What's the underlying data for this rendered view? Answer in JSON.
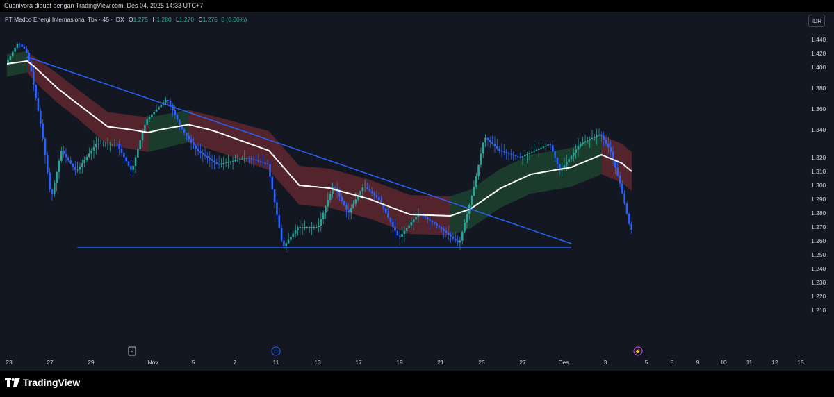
{
  "header": {
    "attribution": "Cuanivora dibuat dengan TradingView.com, Des 04, 2025 14:33 UTC+7"
  },
  "legend": {
    "symbol": "PT Medco Energi Internasional Tbk · 45 · IDX",
    "open_label": "O",
    "open": "1.275",
    "high_label": "H",
    "high": "1.280",
    "low_label": "L",
    "low": "1.270",
    "close_label": "C",
    "close": "1.275",
    "change": "0 (0,00%)"
  },
  "currency_button": "IDR",
  "brand": {
    "name": "TradingView"
  },
  "colors": {
    "background": "#131722",
    "up": "#26a69a",
    "down": "#2962ff",
    "trendline": "#2962ff",
    "band_bear": "#6b2a30",
    "band_bull": "#1f4a31",
    "ma_line": "#ffffff"
  },
  "chart_data": {
    "type": "candlestick",
    "yaxis": {
      "ticks": [
        "1.440",
        "1.420",
        "1.400",
        "1.380",
        "1.360",
        "1.340",
        "1.320",
        "1.310",
        "1.300",
        "1.290",
        "1.280",
        "1.270",
        "1.260",
        "1.250",
        "1.240",
        "1.230",
        "1.220",
        "1.210"
      ]
    },
    "xaxis": {
      "ticks": [
        "23",
        "27",
        "29",
        "Nov",
        "5",
        "7",
        "11",
        "13",
        "17",
        "19",
        "21",
        "25",
        "27",
        "Des",
        "3",
        "5",
        "8",
        "9",
        "10",
        "11",
        "12",
        "15"
      ]
    },
    "price_path": [
      {
        "x": 0,
        "y": 1.405
      },
      {
        "x": 1.2,
        "y": 1.435
      },
      {
        "x": 2,
        "y": 1.425
      },
      {
        "x": 3,
        "y": 1.37
      },
      {
        "x": 4.5,
        "y": 1.29
      },
      {
        "x": 5.5,
        "y": 1.325
      },
      {
        "x": 7,
        "y": 1.31
      },
      {
        "x": 9,
        "y": 1.33
      },
      {
        "x": 11,
        "y": 1.33
      },
      {
        "x": 12.5,
        "y": 1.31
      },
      {
        "x": 14,
        "y": 1.35
      },
      {
        "x": 16,
        "y": 1.37
      },
      {
        "x": 17.5,
        "y": 1.34
      },
      {
        "x": 19,
        "y": 1.325
      },
      {
        "x": 21,
        "y": 1.315
      },
      {
        "x": 24,
        "y": 1.32
      },
      {
        "x": 26,
        "y": 1.315
      },
      {
        "x": 27.5,
        "y": 1.255
      },
      {
        "x": 29,
        "y": 1.27
      },
      {
        "x": 31,
        "y": 1.27
      },
      {
        "x": 32.5,
        "y": 1.3
      },
      {
        "x": 34,
        "y": 1.28
      },
      {
        "x": 35.5,
        "y": 1.3
      },
      {
        "x": 37,
        "y": 1.29
      },
      {
        "x": 39,
        "y": 1.262
      },
      {
        "x": 41,
        "y": 1.28
      },
      {
        "x": 43,
        "y": 1.27
      },
      {
        "x": 45,
        "y": 1.258
      },
      {
        "x": 46.5,
        "y": 1.3
      },
      {
        "x": 47.5,
        "y": 1.335
      },
      {
        "x": 49,
        "y": 1.325
      },
      {
        "x": 51,
        "y": 1.32
      },
      {
        "x": 54,
        "y": 1.33
      },
      {
        "x": 55,
        "y": 1.31
      },
      {
        "x": 57,
        "y": 1.33
      },
      {
        "x": 59,
        "y": 1.337
      },
      {
        "x": 60,
        "y": 1.325
      },
      {
        "x": 61,
        "y": 1.3
      },
      {
        "x": 62,
        "y": 1.268
      }
    ],
    "moving_average": [
      {
        "x": 0,
        "y": 1.405
      },
      {
        "x": 2,
        "y": 1.409
      },
      {
        "x": 3,
        "y": 1.398
      },
      {
        "x": 5,
        "y": 1.38
      },
      {
        "x": 7,
        "y": 1.365
      },
      {
        "x": 10,
        "y": 1.343
      },
      {
        "x": 14,
        "y": 1.338
      },
      {
        "x": 18,
        "y": 1.345
      },
      {
        "x": 21,
        "y": 1.338
      },
      {
        "x": 26,
        "y": 1.325
      },
      {
        "x": 29,
        "y": 1.3
      },
      {
        "x": 32,
        "y": 1.298
      },
      {
        "x": 36,
        "y": 1.29
      },
      {
        "x": 40,
        "y": 1.279
      },
      {
        "x": 44,
        "y": 1.278
      },
      {
        "x": 46,
        "y": 1.283
      },
      {
        "x": 49,
        "y": 1.298
      },
      {
        "x": 52,
        "y": 1.308
      },
      {
        "x": 56,
        "y": 1.313
      },
      {
        "x": 59,
        "y": 1.322
      },
      {
        "x": 61,
        "y": 1.316
      },
      {
        "x": 62,
        "y": 1.31
      }
    ],
    "trendlines": [
      {
        "from": {
          "x": 2,
          "y": 1.415
        },
        "to": {
          "x": 56,
          "y": 1.258
        }
      },
      {
        "from": {
          "x": 7,
          "y": 1.255
        },
        "to": {
          "x": 56,
          "y": 1.255
        }
      }
    ],
    "event_markers": [
      "E",
      "D",
      "⚡"
    ]
  }
}
